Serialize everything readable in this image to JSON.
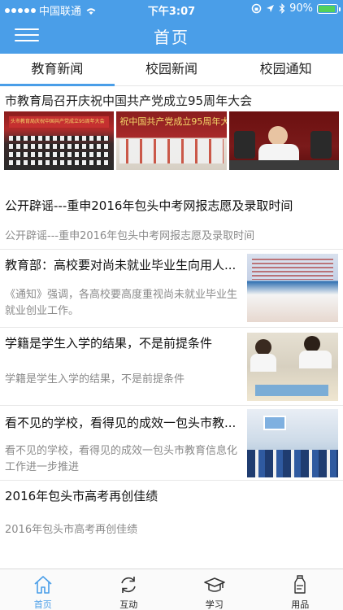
{
  "status_bar": {
    "carrier": "中国联通",
    "time": "下午3:07",
    "battery": "90%",
    "battery_level": 0.9
  },
  "header": {
    "title": "首页"
  },
  "tabs": [
    {
      "label": "教育新闻",
      "active": true
    },
    {
      "label": "校园新闻",
      "active": false
    },
    {
      "label": "校园通知",
      "active": false
    }
  ],
  "featured": {
    "title": "市教育局召开庆祝中国共产党成立95周年大会",
    "photo_banner_text": "头市教育局庆祝中国共产党成立95周年大会",
    "photo2_banner_text": "祝中国共产党成立95周年大"
  },
  "articles": [
    {
      "title": "公开辟谣---重申2016年包头中考网报志愿及录取时间",
      "desc": "公开辟谣---重申2016年包头中考网报志愿及录取时间",
      "has_thumb": false
    },
    {
      "title": "教育部：高校要对尚未就业毕业生向用人...",
      "desc": "《通知》强调，各高校要高度重视尚未就业毕业生就业创业工作。",
      "has_thumb": true
    },
    {
      "title": "学籍是学生入学的结果，不是前提条件",
      "desc": "学籍是学生入学的结果，不是前提条件",
      "has_thumb": true
    },
    {
      "title": "看不见的学校，看得见的成效一包头市教...",
      "desc": "看不见的学校，看得见的成效一包头市教育信息化工作进一步推进",
      "has_thumb": true
    },
    {
      "title": "2016年包头市高考再创佳绩",
      "desc": "2016年包头市高考再创佳绩",
      "has_thumb": false
    }
  ],
  "tabbar": [
    {
      "label": "首页",
      "icon": "home-icon",
      "active": true
    },
    {
      "label": "互动",
      "icon": "refresh-icon",
      "active": false
    },
    {
      "label": "学习",
      "icon": "graduation-cap-icon",
      "active": false
    },
    {
      "label": "用品",
      "icon": "bottle-icon",
      "active": false
    }
  ],
  "colors": {
    "brand": "#4a9ee8",
    "battery": "#52d15a"
  }
}
